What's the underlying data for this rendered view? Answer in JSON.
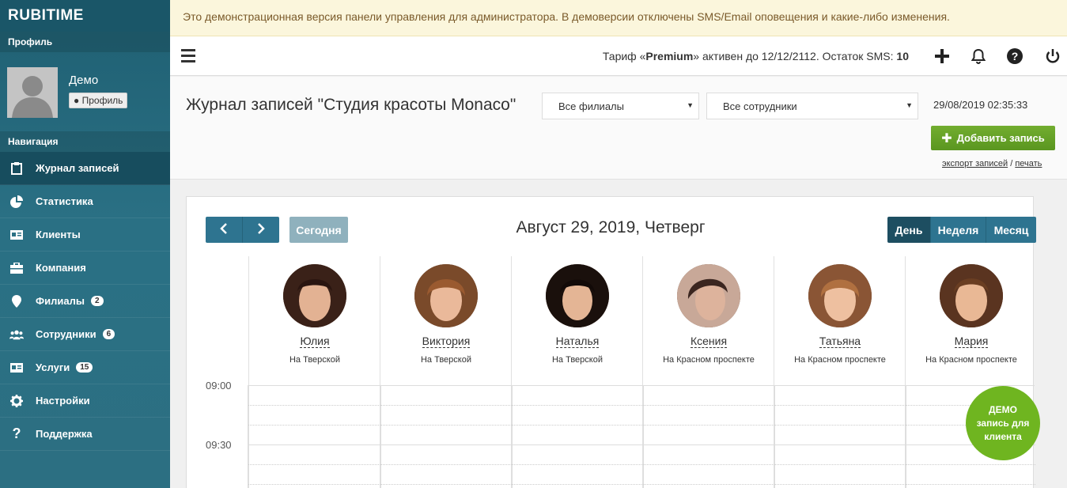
{
  "sidebar": {
    "brand": "RUBITIME",
    "profile_label": "Профиль",
    "user_name": "Демо",
    "profile_button": "Профиль",
    "nav_label": "Навигация",
    "items": [
      {
        "label": "Журнал записей",
        "icon": "clipboard-icon",
        "active": true
      },
      {
        "label": "Статистика",
        "icon": "pie-chart-icon"
      },
      {
        "label": "Клиенты",
        "icon": "id-card-icon"
      },
      {
        "label": "Компания",
        "icon": "briefcase-icon"
      },
      {
        "label": "Филиалы",
        "icon": "map-marker-icon",
        "badge": "2"
      },
      {
        "label": "Сотрудники",
        "icon": "users-icon",
        "badge": "6"
      },
      {
        "label": "Услуги",
        "icon": "list-card-icon",
        "badge": "15"
      },
      {
        "label": "Настройки",
        "icon": "gear-icon"
      },
      {
        "label": "Поддержка",
        "icon": "question-icon"
      }
    ]
  },
  "banner": {
    "text": "Это демонстрационная версия панели управления для администратора. В демоверсии отключены SMS/Email оповещения и какие-либо изменения."
  },
  "topbar": {
    "tariff_prefix": "Тариф «",
    "tariff_name": "Premium",
    "tariff_suffix": "» активен до 12/12/2112. Остаток SMS: ",
    "sms_count": "10"
  },
  "header": {
    "title": "Журнал записей \"Студия красоты Monaco\"",
    "branch_select": "Все филиалы",
    "staff_select": "Все сотрудники",
    "datetime": "29/08/2019 02:35:33",
    "add_button": "Добавить запись",
    "export_link": "экспорт записей",
    "separator": "/",
    "print_link": "печать"
  },
  "calendar": {
    "today_button": "Сегодня",
    "date_title": "Август 29, 2019, Четверг",
    "views": [
      "День",
      "Неделя",
      "Месяц"
    ],
    "active_view": "День",
    "staff": [
      {
        "name": "Юлия",
        "branch": "На Тверской"
      },
      {
        "name": "Виктория",
        "branch": "На Тверской"
      },
      {
        "name": "Наталья",
        "branch": "На Тверской"
      },
      {
        "name": "Ксения",
        "branch": "На Красном проспекте"
      },
      {
        "name": "Татьяна",
        "branch": "На Красном проспекте"
      },
      {
        "name": "Мария",
        "branch": "На Красном проспекте"
      }
    ],
    "times": [
      "09:00",
      "09:30"
    ]
  },
  "demo_bubble": {
    "line1": "ДЕМО",
    "line2": "запись для клиента"
  },
  "colors": {
    "sidebar": "#2a7084",
    "accent_green": "#5a9620",
    "cal_button": "#2e7490",
    "banner_bg": "#fbf6dc"
  }
}
